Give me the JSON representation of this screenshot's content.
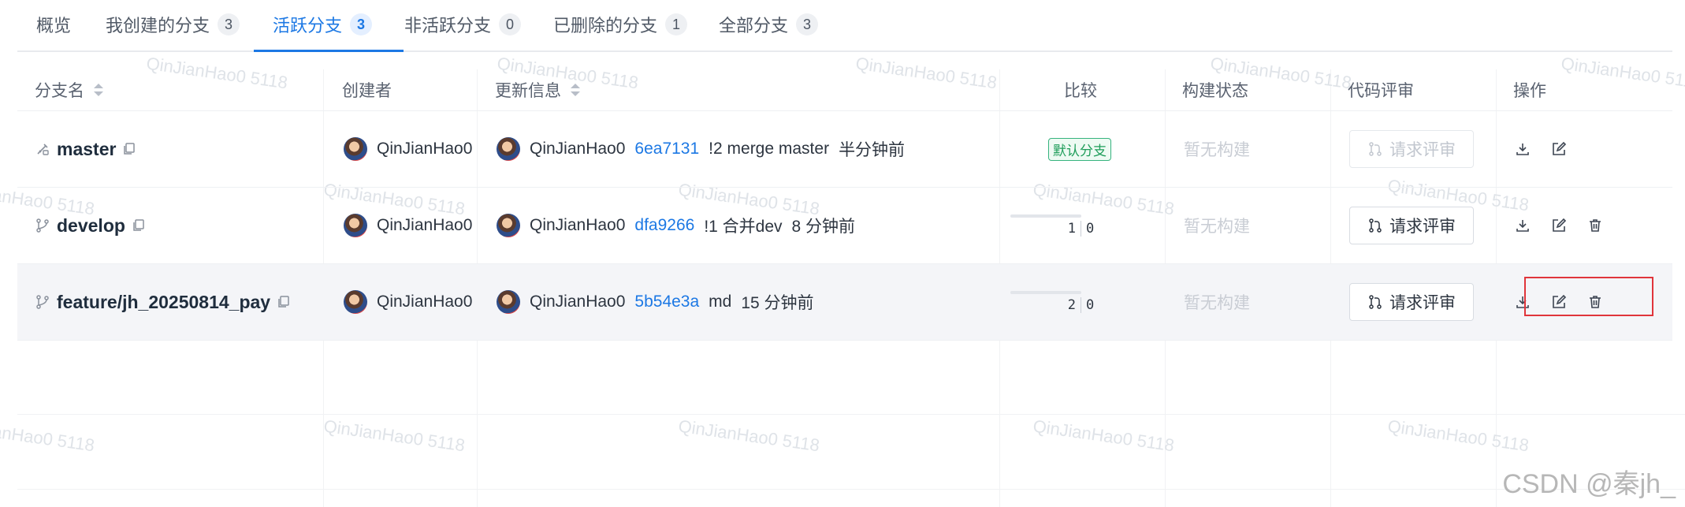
{
  "watermark": "QinJianHao0 5118",
  "tabs": [
    {
      "label": "概览",
      "count": null,
      "active": false
    },
    {
      "label": "我创建的分支",
      "count": "3",
      "active": false
    },
    {
      "label": "活跃分支",
      "count": "3",
      "active": true
    },
    {
      "label": "非活跃分支",
      "count": "0",
      "active": false
    },
    {
      "label": "已删除的分支",
      "count": "1",
      "active": false
    },
    {
      "label": "全部分支",
      "count": "3",
      "active": false
    }
  ],
  "columns": {
    "branch": "分支名",
    "creator": "创建者",
    "update": "更新信息",
    "compare": "比较",
    "build": "构建状态",
    "review": "代码评审",
    "ops": "操作"
  },
  "rows": [
    {
      "branch": "master",
      "creator": "QinJianHao0",
      "author": "QinJianHao0",
      "sha": "6ea7131",
      "message": "!2 merge master",
      "time": "半分钟前",
      "default_badge": "默认分支",
      "behind": "",
      "ahead": "",
      "build": "暂无构建",
      "review": "请求评审",
      "review_enabled": false
    },
    {
      "branch": "develop",
      "creator": "QinJianHao0",
      "author": "QinJianHao0",
      "sha": "dfa9266",
      "message": "!1 合并dev",
      "time": "8 分钟前",
      "default_badge": "",
      "behind": "1",
      "ahead": "0",
      "build": "暂无构建",
      "review": "请求评审",
      "review_enabled": true
    },
    {
      "branch": "feature/jh_20250814_pay",
      "creator": "QinJianHao0",
      "author": "QinJianHao0",
      "sha": "5b54e3a",
      "message": "md",
      "time": "15 分钟前",
      "default_badge": "",
      "behind": "2",
      "ahead": "0",
      "build": "暂无构建",
      "review": "请求评审",
      "review_enabled": true
    }
  ],
  "footer_watermark": "CSDN @秦jh_",
  "colors": {
    "accent": "#1c78e4",
    "default_badge": "#36b37e",
    "highlight_box": "#e0353b"
  }
}
